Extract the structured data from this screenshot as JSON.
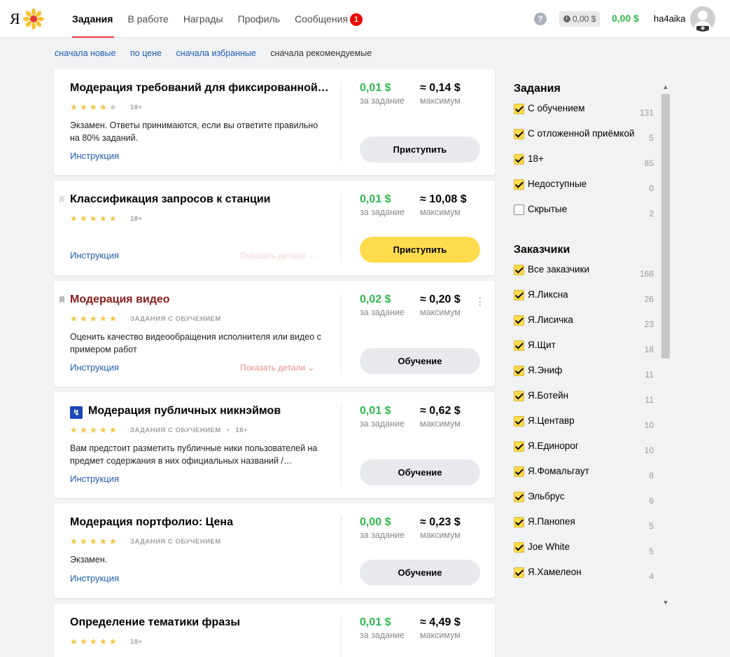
{
  "header": {
    "logo_letter": "Я",
    "nav": [
      {
        "label": "Задания"
      },
      {
        "label": "В работе"
      },
      {
        "label": "Награды"
      },
      {
        "label": "Профиль"
      },
      {
        "label": "Сообщения",
        "badge": "1"
      }
    ],
    "help": "?",
    "pending_balance": "0,00 $",
    "balance": "0,00 $",
    "username": "ha4aika"
  },
  "sort": {
    "options": [
      "сначала новые",
      "по цене",
      "сначала избранные",
      "сначала рекомендуемые"
    ],
    "selected": "сначала рекомендуемые"
  },
  "tasks": [
    {
      "title": "Модерация требований для фиксированной…",
      "rating": 4,
      "tags": [
        "18+"
      ],
      "description": "Экзамен. Ответы принимаются, если вы ответите правильно на 80% заданий.",
      "instruction": "Инструкция",
      "details": "",
      "price": "0,01 $",
      "price_label": "за задание",
      "max": "≈ 0,14 $",
      "max_label": "максимум",
      "button": "Приступить",
      "button_style": "grey"
    },
    {
      "title": "Классификация запросов к станции",
      "rating": 4.5,
      "tags": [
        "18+"
      ],
      "description": "",
      "instruction": "Инструкция",
      "details": "Показать детали ⌄",
      "price": "0,01 $",
      "price_label": "за задание",
      "max": "≈ 10,08 $",
      "max_label": "максимум",
      "button": "Приступить",
      "button_style": "yellow"
    },
    {
      "title": "Модерация видео",
      "rating": 5,
      "tags": [
        "ЗАДАНИЯ С ОБУЧЕНИЕМ"
      ],
      "description": "Оценить качество видеообращения исполнителя или видео с примером работ",
      "instruction": "Инструкция",
      "details": "Показать детали ⌄",
      "price": "0,02 $",
      "price_label": "за задание",
      "max": "≈ 0,20 $",
      "max_label": "максимум",
      "button": "Обучение",
      "button_style": "grey"
    },
    {
      "title": "Модерация публичных никнэймов",
      "rating": 5,
      "tags": [
        "ЗАДАНИЯ С ОБУЧЕНИЕМ",
        "18+"
      ],
      "description": "Вам предстоит разметить публичные ники пользователей на предмет содержания в них официальных названий /…",
      "instruction": "Инструкция",
      "details": "",
      "price": "0,01 $",
      "price_label": "за задание",
      "max": "≈ 0,62 $",
      "max_label": "максимум",
      "button": "Обучение",
      "button_style": "grey"
    },
    {
      "title": "Модерация портфолио: Цена",
      "rating": 5,
      "tags": [
        "ЗАДАНИЯ С ОБУЧЕНИЕМ"
      ],
      "description": "Экзамен.",
      "instruction": "Инструкция",
      "details": "",
      "price": "0,00 $",
      "price_label": "за задание",
      "max": "≈ 0,23 $",
      "max_label": "максимум",
      "button": "Обучение",
      "button_style": "grey"
    },
    {
      "title": "Определение тематики фразы",
      "rating": 5,
      "tags": [
        "18+"
      ],
      "description": "",
      "instruction": "",
      "details": "",
      "price": "0,01 $",
      "price_label": "за задание",
      "max": "≈ 4,49 $",
      "max_label": "максимум",
      "button": "",
      "button_style": "grey"
    }
  ],
  "sidebar": {
    "tasks_title": "Задания",
    "task_filters": [
      {
        "label": "С обучением",
        "count": "131",
        "checked": true
      },
      {
        "label": "С отложенной приёмкой",
        "count": "5",
        "checked": true
      },
      {
        "label": "18+",
        "count": "85",
        "checked": true
      },
      {
        "label": "Недоступные",
        "count": "0",
        "checked": true
      },
      {
        "label": "Скрытые",
        "count": "2",
        "checked": false
      }
    ],
    "customers_title": "Заказчики",
    "customer_filters": [
      {
        "label": "Все заказчики",
        "count": "168",
        "checked": true
      },
      {
        "label": "Я.Ликсна",
        "count": "26",
        "checked": true
      },
      {
        "label": "Я.Лисичка",
        "count": "23",
        "checked": true
      },
      {
        "label": "Я.Щит",
        "count": "18",
        "checked": true
      },
      {
        "label": "Я.Эниф",
        "count": "11",
        "checked": true
      },
      {
        "label": "Я.Ботейн",
        "count": "11",
        "checked": true
      },
      {
        "label": "Я.Центавр",
        "count": "10",
        "checked": true
      },
      {
        "label": "Я.Единорог",
        "count": "10",
        "checked": true
      },
      {
        "label": "Я.Фомальгаут",
        "count": "8",
        "checked": true
      },
      {
        "label": "Эльбрус",
        "count": "6",
        "checked": true
      },
      {
        "label": "Я.Панопея",
        "count": "5",
        "checked": true
      },
      {
        "label": "Joe White",
        "count": "5",
        "checked": true
      },
      {
        "label": "Я.Хамелеон",
        "count": "4",
        "checked": true
      }
    ]
  }
}
